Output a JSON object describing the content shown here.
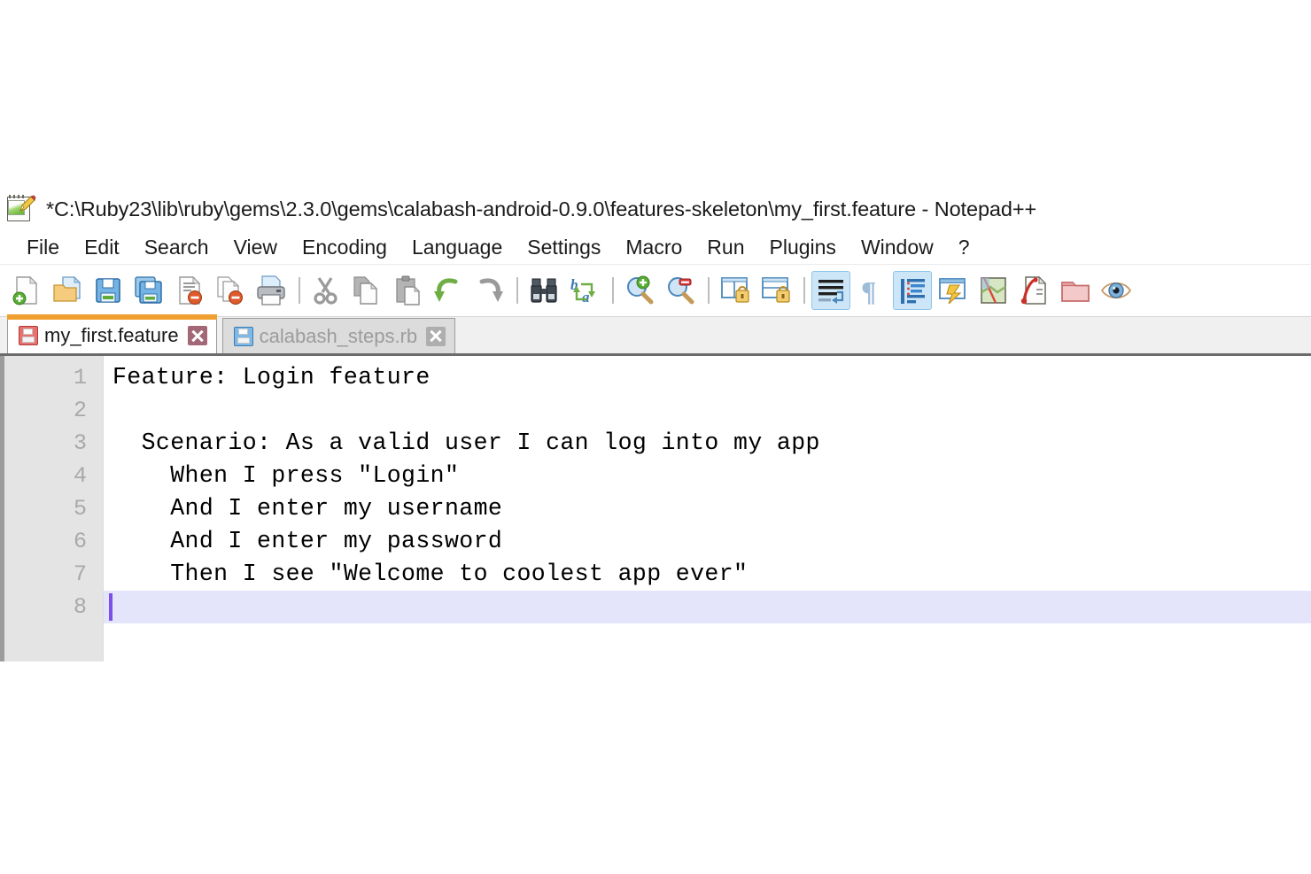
{
  "window": {
    "title": "*C:\\Ruby23\\lib\\ruby\\gems\\2.3.0\\gems\\calabash-android-0.9.0\\features-skeleton\\my_first.feature - Notepad++",
    "app_icon": "notepad-plus-plus-icon",
    "modified": true
  },
  "menubar": {
    "items": [
      {
        "label": "File"
      },
      {
        "label": "Edit"
      },
      {
        "label": "Search"
      },
      {
        "label": "View"
      },
      {
        "label": "Encoding"
      },
      {
        "label": "Language"
      },
      {
        "label": "Settings"
      },
      {
        "label": "Macro"
      },
      {
        "label": "Run"
      },
      {
        "label": "Plugins"
      },
      {
        "label": "Window"
      },
      {
        "label": "?"
      }
    ]
  },
  "toolbar": {
    "buttons": [
      {
        "icon": "new-file-icon",
        "label": "New",
        "active": false
      },
      {
        "icon": "open-folder-icon",
        "label": "Open",
        "active": false
      },
      {
        "icon": "save-icon",
        "label": "Save",
        "active": false
      },
      {
        "icon": "save-all-icon",
        "label": "Save All",
        "active": false
      },
      {
        "icon": "close-file-icon",
        "label": "Close",
        "active": false
      },
      {
        "icon": "close-all-icon",
        "label": "Close All",
        "active": false
      },
      {
        "icon": "print-icon",
        "label": "Print",
        "active": false
      },
      {
        "icon": "separator",
        "label": "",
        "active": false
      },
      {
        "icon": "cut-scissors-icon",
        "label": "Cut",
        "active": false
      },
      {
        "icon": "copy-icon",
        "label": "Copy",
        "active": false
      },
      {
        "icon": "paste-icon",
        "label": "Paste",
        "active": false
      },
      {
        "icon": "undo-arrow-icon",
        "label": "Undo",
        "active": false
      },
      {
        "icon": "redo-arrow-icon",
        "label": "Redo",
        "active": false
      },
      {
        "icon": "separator",
        "label": "",
        "active": false
      },
      {
        "icon": "find-binoculars-icon",
        "label": "Find",
        "active": false
      },
      {
        "icon": "replace-icon",
        "label": "Replace",
        "active": false
      },
      {
        "icon": "separator",
        "label": "",
        "active": false
      },
      {
        "icon": "zoom-in-icon",
        "label": "Zoom In",
        "active": false
      },
      {
        "icon": "zoom-out-icon",
        "label": "Zoom Out",
        "active": false
      },
      {
        "icon": "separator",
        "label": "",
        "active": false
      },
      {
        "icon": "sync-vertical-scroll-icon",
        "label": "Synchronize Vertical Scrolling",
        "active": false
      },
      {
        "icon": "sync-horizontal-scroll-icon",
        "label": "Synchronize Horizontal Scrolling",
        "active": false
      },
      {
        "icon": "separator",
        "label": "",
        "active": false
      },
      {
        "icon": "word-wrap-icon",
        "label": "Word Wrap",
        "active": true
      },
      {
        "icon": "show-all-characters-icon",
        "label": "Show All Characters",
        "active": false
      },
      {
        "icon": "indent-guide-icon",
        "label": "Show Indent Guide",
        "active": true
      },
      {
        "icon": "user-defined-dialog-icon",
        "label": "User-Defined Dialogue",
        "active": false
      },
      {
        "icon": "document-map-icon",
        "label": "Document Map",
        "active": false
      },
      {
        "icon": "function-list-icon",
        "label": "Function List",
        "active": false
      },
      {
        "icon": "folder-as-workspace-icon",
        "label": "Folder as Workspace",
        "active": false
      },
      {
        "icon": "monitoring-eye-icon",
        "label": "Monitoring",
        "active": false
      }
    ]
  },
  "tabs": [
    {
      "label": "my_first.feature",
      "icon": "floppy-red-icon",
      "close_icon": "close-icon",
      "active": true
    },
    {
      "label": "calabash_steps.rb",
      "icon": "floppy-blue-icon",
      "close_icon": "close-icon",
      "active": false
    }
  ],
  "editor": {
    "language": "Gherkin",
    "caret_line": 8,
    "caret_column": 1,
    "lines": [
      {
        "number": "1",
        "text": "Feature: Login feature",
        "current": false
      },
      {
        "number": "2",
        "text": "",
        "current": false
      },
      {
        "number": "3",
        "text": "  Scenario: As a valid user I can log into my app",
        "current": false
      },
      {
        "number": "4",
        "text": "    When I press \"Login\"",
        "current": false
      },
      {
        "number": "5",
        "text": "    And I enter my username",
        "current": false
      },
      {
        "number": "6",
        "text": "    And I enter my password",
        "current": false
      },
      {
        "number": "7",
        "text": "    Then I see \"Welcome to coolest app ever\"",
        "current": false
      },
      {
        "number": "8",
        "text": "",
        "current": true
      }
    ]
  },
  "colors": {
    "active_tab_accent": "#f0a030",
    "active_line_highlight": "#e4e4fa",
    "caret": "#7b4fe8",
    "gutter_bg": "#e4e4e4",
    "gutter_text": "#a9a9a9",
    "toolbar_active_bg": "#cde6f7",
    "tabbar_bg": "#f0f0f0",
    "inactive_tab_text": "#9c9c9c"
  }
}
